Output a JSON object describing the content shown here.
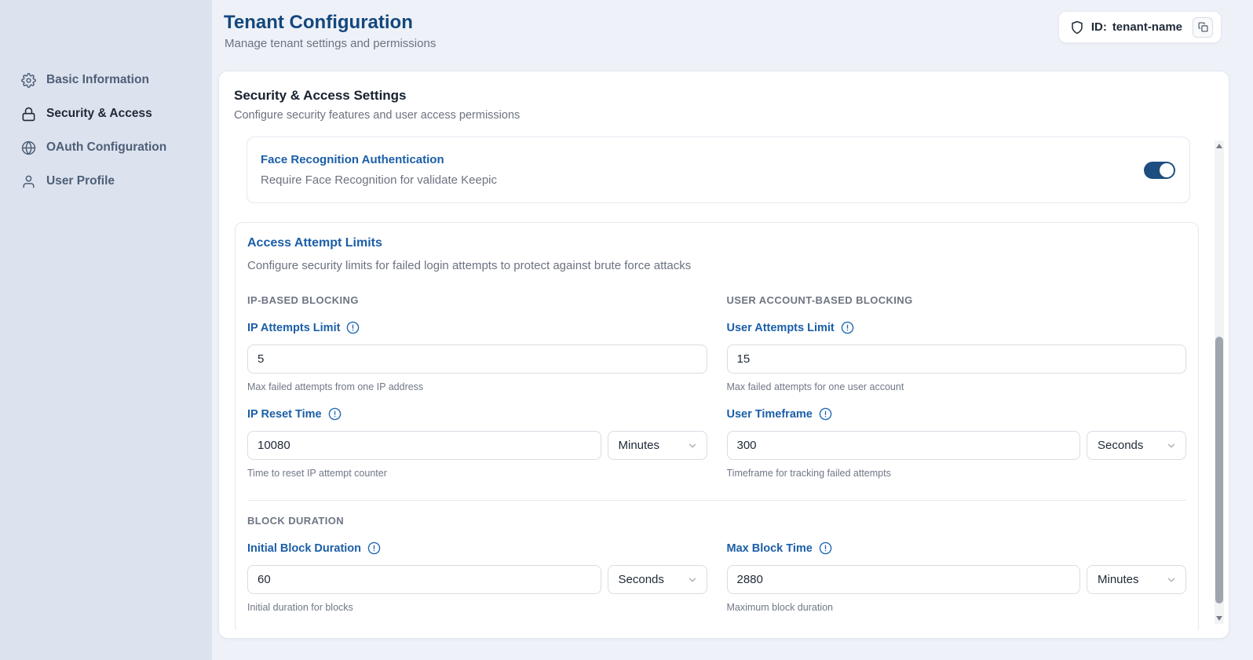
{
  "header": {
    "title": "Tenant Configuration",
    "subtitle": "Manage tenant settings and permissions",
    "tenant_badge": {
      "label": "ID:",
      "value": "tenant-name"
    }
  },
  "sidebar": {
    "items": [
      {
        "label": "Basic Information",
        "icon": "gear-icon",
        "active": false
      },
      {
        "label": "Security & Access",
        "icon": "lock-icon",
        "active": true
      },
      {
        "label": "OAuth Configuration",
        "icon": "globe-icon",
        "active": false
      },
      {
        "label": "User Profile",
        "icon": "user-icon",
        "active": false
      }
    ]
  },
  "panel": {
    "title": "Security & Access Settings",
    "subtitle": "Configure security features and user access permissions",
    "face_recognition": {
      "title": "Face Recognition Authentication",
      "description": "Require Face Recognition for validate Keepic",
      "toggle_state": "on"
    },
    "access_limits": {
      "title": "Access Attempt Limits",
      "description": "Configure security limits for failed login attempts to protect against brute force attacks",
      "sections": {
        "ip": "IP-BASED BLOCKING",
        "user": "USER ACCOUNT-BASED BLOCKING",
        "block": "BLOCK DURATION"
      },
      "fields": {
        "ip_attempts": {
          "label": "IP Attempts Limit",
          "value": "5",
          "helper": "Max failed attempts from one IP address"
        },
        "user_attempts": {
          "label": "User Attempts Limit",
          "value": "15",
          "helper": "Max failed attempts for one user account"
        },
        "ip_reset": {
          "label": "IP Reset Time",
          "value": "10080",
          "unit": "Minutes",
          "helper": "Time to reset IP attempt counter"
        },
        "user_timeframe": {
          "label": "User Timeframe",
          "value": "300",
          "unit": "Seconds",
          "helper": "Timeframe for tracking failed attempts"
        },
        "initial_block": {
          "label": "Initial Block Duration",
          "value": "60",
          "unit": "Seconds",
          "helper": "Initial duration for blocks"
        },
        "max_block": {
          "label": "Max Block Time",
          "value": "2880",
          "unit": "Minutes",
          "helper": "Maximum block duration"
        }
      }
    }
  },
  "colors": {
    "title_navy": "#14477d",
    "accent_blue": "#1b5ea7",
    "toggle_on": "#1d4e7f",
    "sidebar_bg": "#dce3ee",
    "page_bg": "#eef2f8"
  }
}
